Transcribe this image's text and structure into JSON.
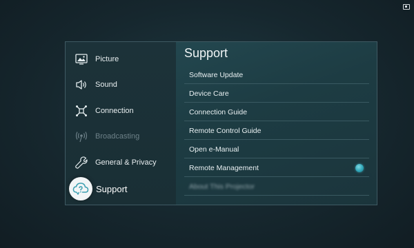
{
  "sidebar": {
    "items": [
      {
        "label": "Picture",
        "icon": "picture-icon",
        "state": "normal"
      },
      {
        "label": "Sound",
        "icon": "speaker-icon",
        "state": "normal"
      },
      {
        "label": "Connection",
        "icon": "network-icon",
        "state": "normal"
      },
      {
        "label": "Broadcasting",
        "icon": "antenna-icon",
        "state": "disabled"
      },
      {
        "label": "General & Privacy",
        "icon": "wrench-icon",
        "state": "normal"
      },
      {
        "label": "Support",
        "icon": "cloud-question-icon",
        "state": "selected"
      }
    ]
  },
  "content": {
    "title": "Support",
    "items": [
      {
        "label": "Software Update"
      },
      {
        "label": "Device Care"
      },
      {
        "label": "Connection Guide"
      },
      {
        "label": "Remote Control Guide"
      },
      {
        "label": "Open e-Manual"
      },
      {
        "label": "Remote Management",
        "toggle": "on"
      },
      {
        "label": "About This Projector",
        "blurred": true
      }
    ]
  },
  "colors": {
    "accent": "#2fa6b8",
    "background": "#14222a",
    "panel": "#1e3940"
  }
}
